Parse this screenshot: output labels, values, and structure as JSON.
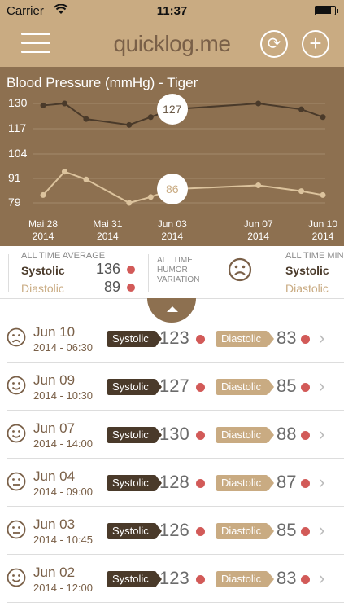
{
  "status": {
    "carrier": "Carrier",
    "time": "11:37",
    "battery_level": 0.85
  },
  "nav": {
    "logo": "quicklog.me",
    "sync_icon": "⟳",
    "add_icon": "+"
  },
  "chart_data": {
    "type": "line",
    "title": "Blood Pressure (mmHg) - Tiger",
    "y_ticks": [
      "130",
      "117",
      "104",
      "91",
      "79"
    ],
    "ylim": [
      79,
      130
    ],
    "x_ticks": [
      {
        "day": "Mai 28",
        "year": "2014"
      },
      {
        "day": "Mai 31",
        "year": "2014"
      },
      {
        "day": "Jun 03",
        "year": "2014"
      },
      {
        "day": "Jun 07",
        "year": "2014"
      },
      {
        "day": "Jun 10",
        "year": "2014"
      }
    ],
    "x_dates": [
      "2014-05-28",
      "2014-05-31",
      "2014-06-03",
      "2014-06-07",
      "2014-06-10"
    ],
    "series": [
      {
        "color": "#4a3a2a",
        "x": [
          "2014-05-28",
          "2014-05-29",
          "2014-05-30",
          "2014-06-01",
          "2014-06-02",
          "2014-06-03",
          "2014-06-07",
          "2014-06-09",
          "2014-06-10"
        ],
        "values": [
          129,
          130,
          122,
          119,
          123,
          127,
          130,
          127,
          123
        ],
        "highlight": {
          "x": "2014-06-03",
          "label": "127"
        }
      },
      {
        "color": "#dcc39d",
        "x": [
          "2014-05-28",
          "2014-05-29",
          "2014-05-30",
          "2014-06-01",
          "2014-06-02",
          "2014-06-03",
          "2014-06-07",
          "2014-06-09",
          "2014-06-10"
        ],
        "values": [
          83,
          95,
          91,
          79,
          82,
          86,
          88,
          85,
          83
        ],
        "highlight": {
          "x": "2014-06-03",
          "label": "86"
        }
      }
    ]
  },
  "summary": {
    "average": {
      "label": "ALL TIME AVERAGE",
      "systolic_label": "Systolic",
      "systolic": "136",
      "diastolic_label": "Diastolic",
      "diastolic": "89"
    },
    "humor": {
      "label_1": "ALL TIME",
      "label_2": "HUMOR",
      "label_3": "VARIATION"
    },
    "minimum": {
      "label": "ALL TIME MIN",
      "systolic_label": "Systolic",
      "diastolic_label": "Diastolic"
    }
  },
  "entries": [
    {
      "date": "Jun 10",
      "sub": "2014 - 06:30",
      "mood": "sad",
      "systolic_label": "Systolic",
      "systolic": "123",
      "diastolic_label": "Diastolic",
      "diastolic": "83"
    },
    {
      "date": "Jun 09",
      "sub": "2014 - 10:30",
      "mood": "happy",
      "systolic_label": "Systolic",
      "systolic": "127",
      "diastolic_label": "Diastolic",
      "diastolic": "85"
    },
    {
      "date": "Jun 07",
      "sub": "2014 - 14:00",
      "mood": "happy",
      "systolic_label": "Systolic",
      "systolic": "130",
      "diastolic_label": "Diastolic",
      "diastolic": "88"
    },
    {
      "date": "Jun 04",
      "sub": "2014 - 09:00",
      "mood": "neutral",
      "systolic_label": "Systolic",
      "systolic": "128",
      "diastolic_label": "Diastolic",
      "diastolic": "87"
    },
    {
      "date": "Jun 03",
      "sub": "2014 - 10:45",
      "mood": "neutral",
      "systolic_label": "Systolic",
      "systolic": "126",
      "diastolic_label": "Diastolic",
      "diastolic": "85"
    },
    {
      "date": "Jun 02",
      "sub": "2014 - 12:00",
      "mood": "happy",
      "systolic_label": "Systolic",
      "systolic": "123",
      "diastolic_label": "Diastolic",
      "diastolic": "83"
    }
  ]
}
